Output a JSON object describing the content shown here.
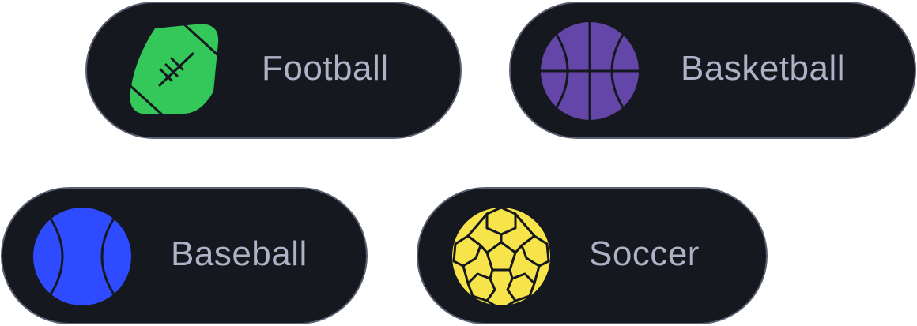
{
  "colors": {
    "chip_background": "#15181e",
    "chip_border": "#5c6072",
    "label_text": "#aeb2c6",
    "football": "#34c759",
    "basketball": "#6445a8",
    "baseball": "#2f4bff",
    "soccer": "#f7e34a",
    "line": "#15181e"
  },
  "sports": [
    {
      "label": "Football",
      "icon": "football-icon"
    },
    {
      "label": "Basketball",
      "icon": "basketball-icon"
    },
    {
      "label": "Baseball",
      "icon": "baseball-icon"
    },
    {
      "label": "Soccer",
      "icon": "soccer-icon"
    }
  ]
}
